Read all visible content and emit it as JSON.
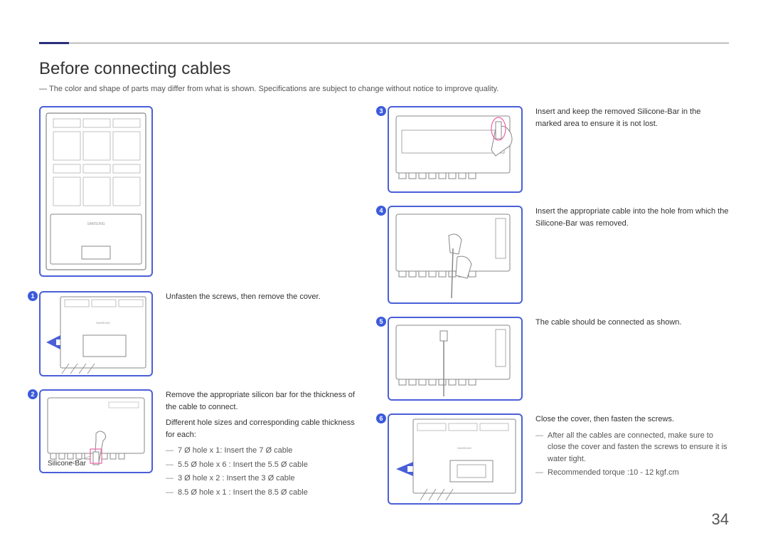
{
  "title": "Before connecting cables",
  "top_note": "The color and shape of parts may differ from what is shown. Specifications are subject to change without notice to improve quality.",
  "silicone_label": "Silicone-Bar",
  "steps": {
    "1": {
      "text": "Unfasten the screws, then remove the cover."
    },
    "2": {
      "text1": "Remove the appropriate silicon bar for the thickness of the cable to connect.",
      "text2": "Different hole sizes and corresponding cable thickness for each:",
      "bullets": [
        "7 Ø hole x 1: Insert the 7 Ø cable",
        "5.5 Ø hole x 6 : Insert the 5.5 Ø cable",
        "3 Ø hole x 2 : Insert the 3 Ø cable",
        "8.5 Ø hole x 1 : Insert the 8.5 Ø cable"
      ]
    },
    "3": {
      "text": "Insert and keep the removed Silicone-Bar in the marked area to ensure it is not lost."
    },
    "4": {
      "text": "Insert the appropriate cable into the hole from which the Silicone-Bar was removed."
    },
    "5": {
      "text": "The cable should be connected as shown."
    },
    "6": {
      "text": "Close the cover, then fasten the screws.",
      "bullets": [
        "After all the cables are connected, make sure to close the cover and fasten the screws to ensure it is water tight.",
        "Recommended torque :10 - 12 kgf.cm"
      ]
    }
  },
  "page_number": "34"
}
